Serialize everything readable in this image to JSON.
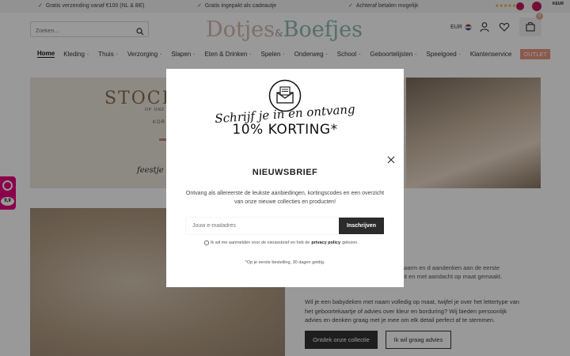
{
  "topbar": {
    "usps": [
      "Gratis verzending vanaf €100 (NL & BE)",
      "Gratis ingepakt als cadeautje",
      "Achteraf betalen mogelijk"
    ],
    "keur_label": "KEUR"
  },
  "header": {
    "search_placeholder": "Zoeken...",
    "logo_left": "Dotjes",
    "logo_amp": "&",
    "logo_right": "Boefjes",
    "currency": "EUR",
    "cart_count": "0"
  },
  "nav": {
    "items": [
      {
        "label": "Home"
      },
      {
        "label": "Kleding"
      },
      {
        "label": "Thuis"
      },
      {
        "label": "Verzorging"
      },
      {
        "label": "Slapen"
      },
      {
        "label": "Eten & Drinken"
      },
      {
        "label": "Spelen"
      },
      {
        "label": "Onderweg"
      },
      {
        "label": "School"
      },
      {
        "label": "Geboortelijsten"
      },
      {
        "label": "Speelgoed"
      },
      {
        "label": "Klantenservice"
      },
      {
        "label": "OUTLET"
      }
    ]
  },
  "hero": {
    "headline": "STOCK",
    "small1": "OP ONZ",
    "small2": "KOR",
    "script": "feestje"
  },
  "content": {
    "text1": "urde babydekentjes met naam – een warm en d aandenken aan de eerste momenten van je baby. Zacht, kwaliteit en met aandacht op maat gemaakt.",
    "text2": "Wil je een babydeken met naam volledig op maat, twijfel je over het lettertype van het geboortekaartje of advies over kleur en borduring? Wij bieden persoonlijk advies en denken graag met je mee om elk detail perfect af te stemmen.",
    "btn_primary": "Ontdek onze collectie",
    "btn_secondary": "Ik wil graag advies"
  },
  "widget": {
    "score": "9,9"
  },
  "modal": {
    "script_line": "Schrijf je in en ontvang",
    "discount": "10% KORTING*",
    "title": "NIEUWSBRIEF",
    "description": "Ontvang als allereerste de leukste aanbiedingen, kortingscodes en een overzicht van onze nieuwe collecties en producten!",
    "email_placeholder": "Jouw e-mailadres",
    "submit_label": "Inschrijven",
    "consent_prefix": "Ik wil me aanmelden voor de nieuwsbrief en heb de",
    "consent_link": "privacy policy",
    "consent_suffix": "gelezen.",
    "footnote": "*Op je eerste bestelling, 30 dagen geldig."
  },
  "colors": {
    "accent": "#e8967f",
    "dark_button": "#2b2b2b",
    "widget_pink": "#e5007e"
  }
}
